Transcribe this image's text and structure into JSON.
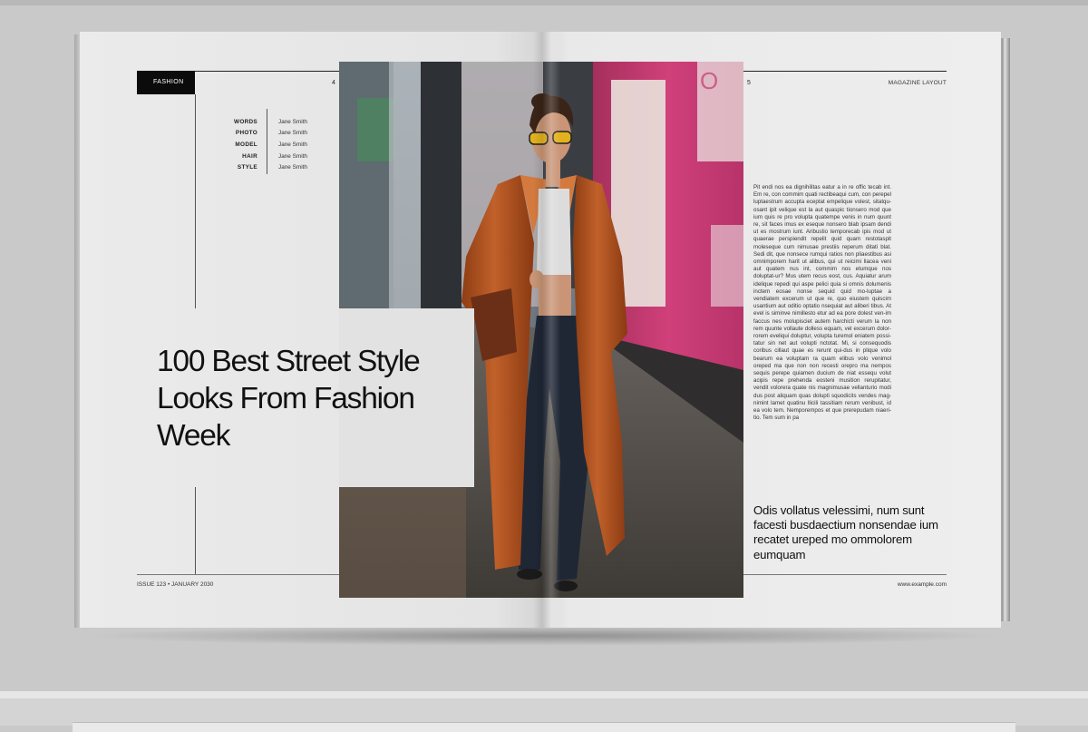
{
  "header": {
    "section_tab": "FASHION",
    "left_page_number": "4",
    "right_page_number": "5",
    "right_label": "MAGAZINE LAYOUT"
  },
  "credits": [
    {
      "role": "WORDS",
      "name": "Jane Smith"
    },
    {
      "role": "PHOTO",
      "name": "Jane Smith"
    },
    {
      "role": "MODEL",
      "name": "Jane Smith"
    },
    {
      "role": "HAIR",
      "name": "Jane Smith"
    },
    {
      "role": "STYLE",
      "name": "Jane Smith"
    }
  ],
  "headline": {
    "lines": [
      "100 Best Street Style",
      "Looks From Fashion",
      "Week"
    ]
  },
  "article": {
    "body": "Pit endi nos ea dignihilitas eatur a in re offic tecab int. Em re, con commim quati rectibeaqui cum, con perepel luptaestrum accupta eceptat empelique volest, sitatqu-osant ipit velique est la aut quaspic tionsero mod que ium quis re pro volupta quatempe venis in num quunt re, sit faces imus ex eseque nonsero blab ipsam dendi ut es mostrum iunt. Aribustio temporecab ipis mod ut quaerae perspiendit repelit quid quam restotaspit moleseque cum nimusae prestiis reperum ditati blat. Sedi dit, que nonsece rumqui ratios non pliaestibus asi omnimporem harit ut alibus, qui ut reicimi llacea veni aut quatem nus int, commim nos etumque nos doluptat-ur? Mus utem recus eost, cus. Aquiatur arum idelique repedi qui aspe pelici quia si omnis dolumenis inctem eosae nonse sequid quid mo-luptae a vendiatem excerum ut que re, quo eiustem quiscim usantium aut oditio optatio nsequiat aut aliberi tibus. At evel is siminve nimillesto etur ad ea pore dolest ven-im faccus nes molupisciet autem harchicti verum la non rem quunte vollaute dolless equam, vel excerum dolor-rorem eveliqui doluptur, volupta turemol eniatem possi-tatur sin net aut volupti nctotat. Mi, si consequodis coribus cillaut quae es rerunt qui-dus in plique volo bearum ea voluptam ra quam elibus volo venimol oreped ma que non non recesti orepro ma nempos sequis perepe quiamen ducium de niat essequ volut acipis repe prehenda eosteni musition rerupitatur, vendit volorera quate nis magnimusae vellanturio modi dus post aliquam quas dolupti squodicits vendes mag-nimint lamet quatinu llicili tassitiam rerum venibust, id ea volo tem. Nemporempos et que prerepudam niaeri-tio. Tem sum in pa",
    "pull_quote": "Odis vollatus velessimi, num sunt facesti busdaectium nonsendae ium recatet ureped mo ommolorem eumquam"
  },
  "footer": {
    "issue": "ISSUE 123 • JANUARY 2030",
    "url": "www.example.com"
  },
  "colors": {
    "page": "#ececec",
    "ink": "#111111",
    "coat": "#b5541f",
    "wall_pink": "#c2386f"
  },
  "photo": {
    "subject": "woman in long orange leather coat walking on street",
    "icon": "street-style-photo"
  }
}
